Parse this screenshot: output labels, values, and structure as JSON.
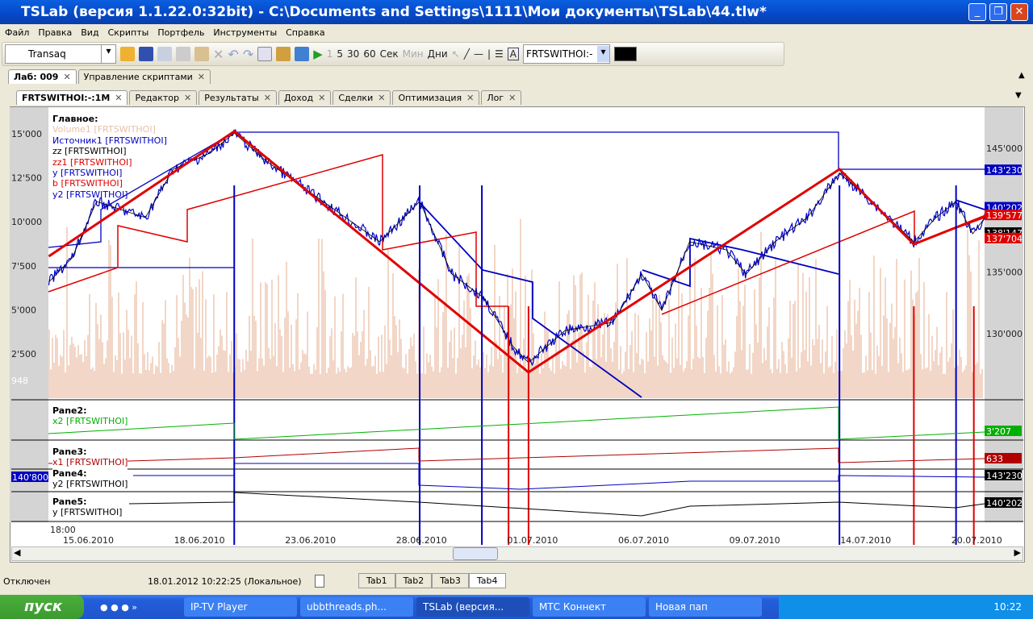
{
  "window": {
    "title": "TSLab (версия 1.1.22.0:32bit) - C:\\Documents and Settings\\1111\\Мои документы\\TSLab\\44.tlw*"
  },
  "menu": [
    "Файл",
    "Правка",
    "Вид",
    "Скрипты",
    "Портфель",
    "Инструменты",
    "Справка"
  ],
  "toolbar": {
    "connector": "Transaq",
    "intervals": [
      "1",
      "5",
      "30",
      "60"
    ],
    "units": [
      "Сек",
      "Мин",
      "Дни"
    ],
    "symbol": "FRTSWITHOI:-",
    "color": "#000000"
  },
  "tabs_top": [
    {
      "label": "Лаб: 009"
    },
    {
      "label": "Управление скриптами"
    }
  ],
  "tabs_inner": [
    {
      "label": "FRTSWITHOI:-:1M"
    },
    {
      "label": "Редактор"
    },
    {
      "label": "Результаты"
    },
    {
      "label": "Доход"
    },
    {
      "label": "Сделки"
    },
    {
      "label": "Оптимизация"
    },
    {
      "label": "Лог"
    }
  ],
  "legend": {
    "title": "Главное:",
    "items": [
      {
        "label": "Volume1 [FRTSWITHOI]",
        "color": "#e8c0a8"
      },
      {
        "label": "Источник1 [FRTSWITHOI]",
        "color": "#0000c0"
      },
      {
        "label": "zz [FRTSWITHOI]",
        "color": "#000000"
      },
      {
        "label": "zz1 [FRTSWITHOI]",
        "color": "#e00000"
      },
      {
        "label": "y [FRTSWITHOI]",
        "color": "#0000c0"
      },
      {
        "label": "b [FRTSWITHOI]",
        "color": "#e00000"
      },
      {
        "label": "y2 [FRTSWITHOI]",
        "color": "#0000c0"
      }
    ]
  },
  "panes": [
    {
      "title": "Pane2:",
      "series": "x2 [FRTSWITHOI]",
      "value": "3'207",
      "color": "#00b000"
    },
    {
      "title": "Pane3:",
      "series": "x1 [FRTSWITHOI]",
      "value": "633",
      "color": "#b00000"
    },
    {
      "title": "Pane4:",
      "series": "y2 [FRTSWITHOI]",
      "value": "143'230",
      "color": "#000000"
    },
    {
      "title": "Pane5:",
      "series": "y [FRTSWITHOI]",
      "value": "140'202",
      "color": "#000000"
    }
  ],
  "cursor_value": "140'800",
  "chart_data": {
    "type": "line",
    "x_ticks": [
      "15.06.2010",
      "18.06.2010",
      "23.06.2010",
      "28.06.2010",
      "01.07.2010",
      "06.07.2010",
      "09.07.2010",
      "14.07.2010",
      "20.07.2010"
    ],
    "x_first_label": "18:00",
    "left_ticks": [
      "15'000",
      "12'500",
      "10'000",
      "7'500",
      "5'000",
      "2'500"
    ],
    "left_current": "948",
    "right_ticks": [
      {
        "label": "145'000",
        "value": 145000
      },
      {
        "label": "135'000",
        "value": 135000
      },
      {
        "label": "130'000",
        "value": 130000
      }
    ],
    "right_markers": [
      {
        "label": "143'230",
        "value": 143230,
        "color": "#0000c0"
      },
      {
        "label": "140'202",
        "value": 140202,
        "color": "#0000c0"
      },
      {
        "label": "139'577",
        "value": 139577,
        "color": "#e00000"
      },
      {
        "label": "138'147",
        "value": 138147,
        "color": "#000000"
      },
      {
        "label": "137'704",
        "value": 137704,
        "color": "#e00000"
      }
    ],
    "price": [
      [
        -0.36,
        134177
      ],
      [
        -0.15,
        136133
      ],
      [
        0.07,
        140697
      ],
      [
        0.29,
        140045
      ],
      [
        0.51,
        139393
      ],
      [
        0.76,
        143305
      ],
      [
        1.09,
        144609
      ],
      [
        1.31,
        146239
      ],
      [
        1.6,
        143957
      ],
      [
        2.11,
        140697
      ],
      [
        2.62,
        137437
      ],
      [
        2.98,
        140697
      ],
      [
        3.27,
        134829
      ],
      [
        3.56,
        132873
      ],
      [
        3.82,
        128961
      ],
      [
        3.96,
        127657
      ],
      [
        4.29,
        130265
      ],
      [
        4.72,
        130917
      ],
      [
        4.98,
        134829
      ],
      [
        5.16,
        131895
      ],
      [
        5.41,
        137437
      ],
      [
        5.74,
        136785
      ],
      [
        5.92,
        134829
      ],
      [
        6.18,
        137437
      ],
      [
        6.47,
        139393
      ],
      [
        6.76,
        142979
      ],
      [
        7.05,
        140697
      ],
      [
        7.43,
        137437
      ],
      [
        7.63,
        139393
      ],
      [
        7.81,
        140697
      ],
      [
        7.96,
        138089
      ],
      [
        8.07,
        139393
      ]
    ],
    "zigzag": [
      [
        -0.36,
        136263
      ],
      [
        1.31,
        146370
      ],
      [
        3.96,
        126874
      ],
      [
        6.76,
        143305
      ],
      [
        7.43,
        137241
      ],
      [
        8.07,
        139523
      ]
    ],
    "blue_verticals": [
      1.31,
      2.98,
      3.54,
      6.76,
      7.81
    ],
    "red_verticals": [
      3.78,
      3.96,
      7.43,
      7.97
    ]
  },
  "status": {
    "connection": "Отключен",
    "datetime": "18.01.2012 10:22:25 (Локальное)",
    "tabs": [
      "Tab1",
      "Tab2",
      "Tab3",
      "Tab4"
    ]
  },
  "taskbar": {
    "start": "пуск",
    "tasks": [
      "IP-TV Player",
      "ubbthreads.ph...",
      "TSLab (версия...",
      "МТС Коннект",
      "Новая пап"
    ],
    "clock": "10:22"
  }
}
